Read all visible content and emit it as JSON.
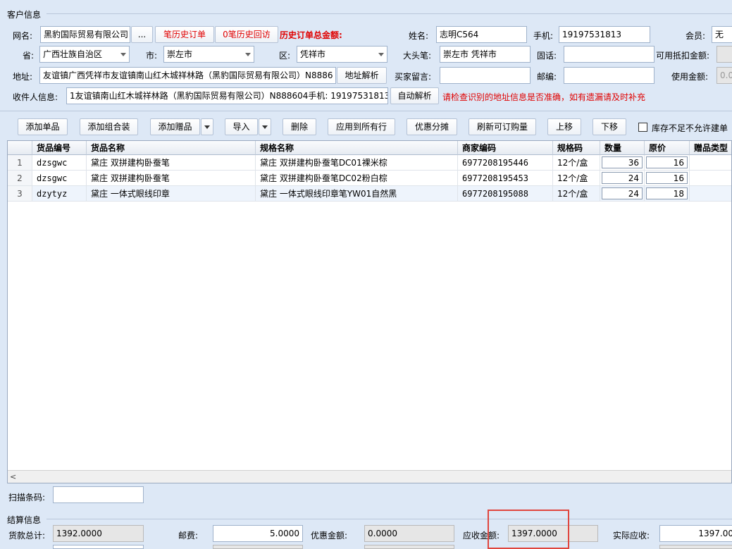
{
  "customer_section": {
    "title": "客户信息"
  },
  "row1": {
    "wangming_label": "网名:",
    "wangming_value": "黑豹国际贸易有限公司",
    "more_btn": "...",
    "history_orders_btn": "笔历史订单",
    "history_visits_btn": "0笔历史回访",
    "history_total_label": "历史订单总金额:",
    "name_label": "姓名:",
    "name_value": "志明C564",
    "phone_label": "手机:",
    "phone_value": "19197531813",
    "member_label": "会员:",
    "member_value": "无"
  },
  "row2": {
    "province_label": "省:",
    "province_value": "广西壮族自治区",
    "city_label": "市:",
    "city_value": "崇左市",
    "district_label": "区:",
    "district_value": "凭祥市",
    "bigpen_label": "大头笔:",
    "bigpen_value": "崇左市 凭祥市",
    "landline_label": "固话:",
    "landline_value": "",
    "deductible_label": "可用抵扣金额:"
  },
  "row3": {
    "address_label": "地址:",
    "address_value": "友谊镇广西凭祥市友谊镇南山红木城祥林路（黑豹国际贸易有限公司）N8886",
    "parse_btn": "地址解析",
    "buyer_msg_label": "买家留言:",
    "buyer_msg_value": "",
    "zip_label": "邮编:",
    "zip_value": "",
    "use_amount_label": "使用金额:",
    "use_amount_value": "0.0"
  },
  "row4": {
    "receiver_label": "收件人信息:",
    "receiver_value": "1友谊镇南山红木城祥林路（黑豹国际贸易有限公司）N888604手机: 19197531813",
    "auto_parse_btn": "自动解析",
    "warning": "请检查识别的地址信息是否准确，如有遗漏请及时补充"
  },
  "toolbar": {
    "add_single": "添加单品",
    "add_combo": "添加组合装",
    "add_gift": "添加赠品",
    "import": "导入",
    "delete": "删除",
    "apply_all": "应用到所有行",
    "discount_split": "优惠分摊",
    "refresh_qty": "刷新可订购量",
    "move_up": "上移",
    "move_down": "下移",
    "stock_check_label": "库存不足不允许建单"
  },
  "table": {
    "headers": [
      "货品编号",
      "货品名称",
      "规格名称",
      "商家编码",
      "规格码",
      "数量",
      "原价",
      "赠品类型"
    ],
    "rows": [
      {
        "no": "1",
        "code": "dzsgwc",
        "name": "黛庄 双拼建构卧蚕笔",
        "spec": "黛庄 双拼建构卧蚕笔DC01裸米棕",
        "merchant": "6977208195446",
        "spec_code": "12个/盒",
        "qty": "36",
        "price": "16"
      },
      {
        "no": "2",
        "code": "dzsgwc",
        "name": "黛庄 双拼建构卧蚕笔",
        "spec": "黛庄 双拼建构卧蚕笔DC02粉白棕",
        "merchant": "6977208195453",
        "spec_code": "12个/盒",
        "qty": "24",
        "price": "16"
      },
      {
        "no": "3",
        "code": "dzytyz",
        "name": "黛庄 一体式眼线印章",
        "spec": "黛庄 一体式眼线印章笔YW01自然黑",
        "merchant": "6977208195088",
        "spec_code": "12个/盒",
        "qty": "24",
        "price": "18"
      }
    ]
  },
  "scan": {
    "label": "扫描条码:",
    "value": ""
  },
  "settle": {
    "title": "结算信息",
    "goods_total_label": "货款总计:",
    "goods_total_value": "1392.0000",
    "postage_label": "邮费:",
    "postage_value": "5.0000",
    "discount_label": "优惠金额:",
    "discount_value": "0.0000",
    "receivable_label": "应收金额:",
    "receivable_value": "1397.0000",
    "actual_label": "实际应收:",
    "actual_value": "1397.00"
  }
}
